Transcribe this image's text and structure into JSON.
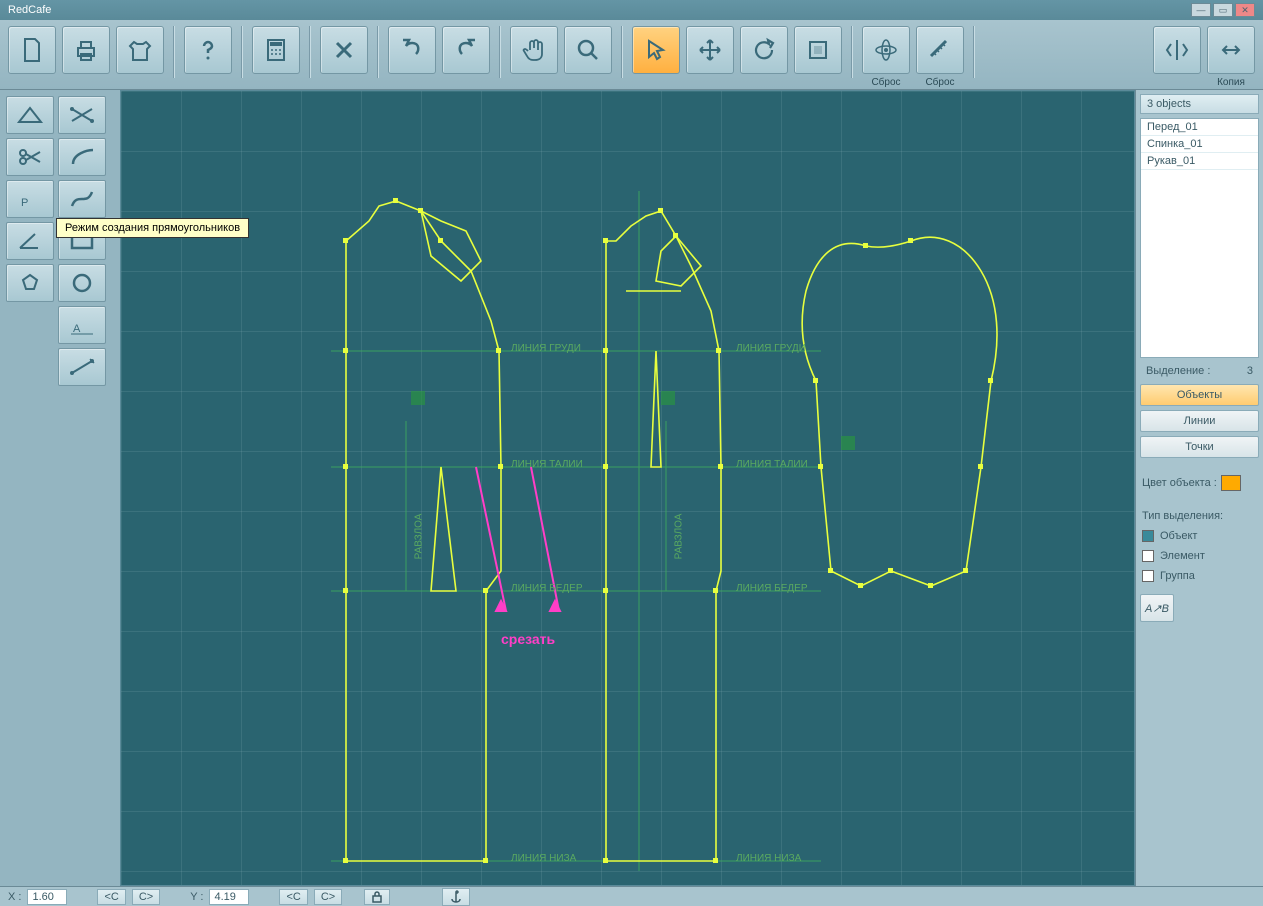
{
  "app": {
    "title": "RedCafe"
  },
  "toolbar_top": {
    "reset1": "Сброс",
    "reset2": "Сброс",
    "copy": "Копия"
  },
  "tooltip": "Режим создания прямоугольников",
  "right": {
    "objects_header": "3 objects",
    "objects": [
      "Перед_01",
      "Спинка_01",
      "Рукав_01"
    ],
    "selection_label": "Выделение :",
    "selection_count": "3",
    "btn_objects": "Объекты",
    "btn_lines": "Линии",
    "btn_points": "Точки",
    "color_label": "Цвет объекта :",
    "type_label": "Тип выделения:",
    "chk_object": "Объект",
    "chk_element": "Элемент",
    "chk_group": "Группа"
  },
  "canvas": {
    "line_chest": "ЛИНИЯ  ГРУДИ",
    "line_waist": "ЛИНИЯ  ТАЛИИ",
    "line_hip": "ЛИНИЯ  БЕДЕР",
    "line_bottom": "ЛИНИЯ  НИЗА",
    "balance": "РАВЗЛОА",
    "cut": "срезать"
  },
  "status": {
    "x_label": "X :",
    "x_val": "1.60",
    "y_label": "Y :",
    "y_val": "4.19",
    "c_lt": "<С",
    "c_gt": "C>"
  }
}
